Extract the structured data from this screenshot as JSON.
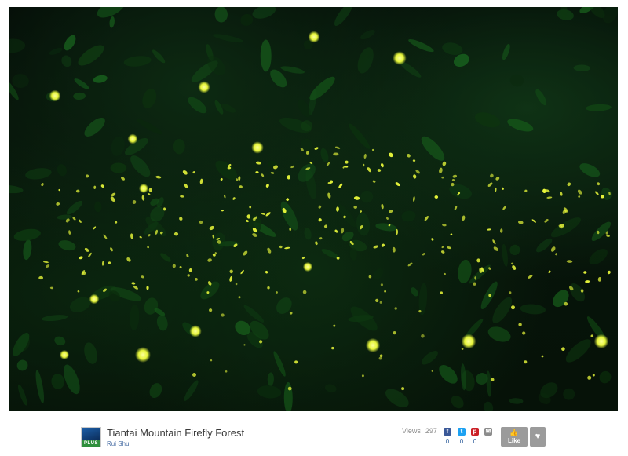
{
  "photo": {
    "alt_subject": "fireflies-forest-night",
    "bg_color": "#050d07",
    "glow_color": "#e6f53a"
  },
  "meta": {
    "title": "Tiantai Mountain Firefly Forest",
    "author": "Rui Shu",
    "avatar_badge": "PLUS",
    "views_label": "Views",
    "views_count": "297"
  },
  "share": [
    {
      "name": "facebook-icon",
      "glyph": "f",
      "color": "#3b5998",
      "count": "0"
    },
    {
      "name": "twitter-icon",
      "glyph": "t",
      "color": "#1da1f2",
      "count": "0"
    },
    {
      "name": "pinterest-icon",
      "glyph": "p",
      "color": "#cb2027",
      "count": "0"
    },
    {
      "name": "email-icon",
      "glyph": "✉",
      "color": "#8c8c8c",
      "count": ""
    }
  ],
  "actions": {
    "like_label": "Like",
    "like_icon": "thumbs-up-icon",
    "fav_icon": "heart-icon"
  }
}
